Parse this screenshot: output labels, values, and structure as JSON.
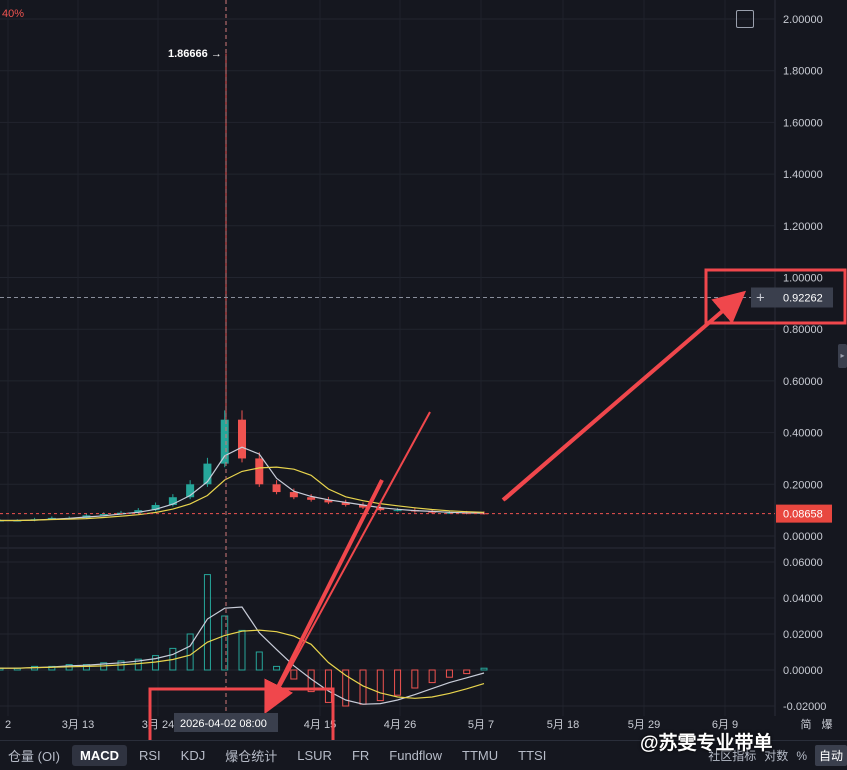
{
  "top_left_percent": "40%",
  "peak_label": "1.86666 →",
  "crosshair": {
    "price_label": "0.92262",
    "time_label": "2026-04-02 08:00",
    "plus_icon": "plus-icon"
  },
  "current_price_label": "0.08658",
  "price_axis_ticks": [
    "2.00000",
    "1.80000",
    "1.60000",
    "1.40000",
    "1.20000",
    "1.00000",
    "0.80000",
    "0.60000",
    "0.40000",
    "0.20000",
    "0.00000"
  ],
  "macd_axis_ticks": [
    "0.06000",
    "0.04000",
    "0.02000",
    "0.00000",
    "-0.02000"
  ],
  "time_axis_ticks": [
    "2",
    "3月 13",
    "3月 24",
    "4月 15",
    "4月 26",
    "5月 7",
    "5月 18",
    "5月 29",
    "6月 9",
    "简",
    "爆"
  ],
  "toolbar": {
    "tabs": [
      "仓量 (OI)",
      "MACD",
      "RSI",
      "KDJ",
      "爆仓统计",
      "LSUR",
      "FR",
      "Fundflow",
      "TTMU",
      "TTSI"
    ],
    "active_tab": "MACD",
    "right_items": [
      "社区指标",
      "对数",
      "%",
      "自动"
    ]
  },
  "watermark": "@苏雯专业带单",
  "colors": {
    "background": "#15171f",
    "up": "#26a69a",
    "down": "#ef5350",
    "annotation": "#f0474c",
    "ma_yellow": "#e8d44d",
    "ma_white": "#c8ccd8",
    "price_tag": "#e8473f"
  },
  "chart_data": {
    "type": "candlestick_with_macd",
    "price_axis": {
      "ylim": [
        0,
        2.0
      ],
      "ticks": [
        0,
        0.2,
        0.4,
        0.6,
        0.8,
        1.0,
        1.2,
        1.4,
        1.6,
        1.8,
        2.0
      ]
    },
    "macd_axis": {
      "ylim": [
        -0.02,
        0.06
      ],
      "ticks": [
        -0.02,
        0,
        0.02,
        0.04,
        0.06
      ]
    },
    "peak_high": 1.86666,
    "last_price": 0.08658,
    "crosshair_price": 0.92262,
    "crosshair_time": "2026-04-02 08:00",
    "price_series_approx": [
      0.06,
      0.06,
      0.065,
      0.07,
      0.07,
      0.08,
      0.085,
      0.09,
      0.1,
      0.12,
      0.15,
      0.2,
      0.28,
      0.45,
      0.3,
      0.2,
      0.17,
      0.15,
      0.14,
      0.13,
      0.12,
      0.11,
      0.1,
      0.1,
      0.095,
      0.09,
      0.09,
      0.088,
      0.087
    ],
    "macd_histogram_approx": [
      0.001,
      0.001,
      0.002,
      0.002,
      0.003,
      0.003,
      0.004,
      0.005,
      0.006,
      0.008,
      0.012,
      0.02,
      0.053,
      0.03,
      0.022,
      0.01,
      0.002,
      -0.005,
      -0.012,
      -0.018,
      -0.02,
      -0.019,
      -0.017,
      -0.014,
      -0.01,
      -0.007,
      -0.004,
      -0.002,
      0.001
    ]
  }
}
